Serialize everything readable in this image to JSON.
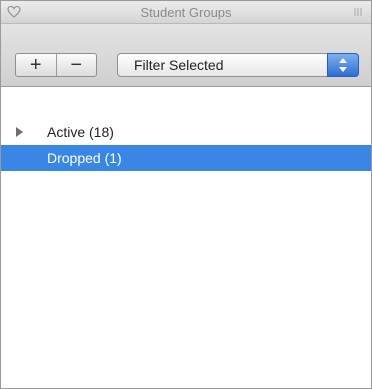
{
  "window": {
    "title": "Student Groups"
  },
  "toolbar": {
    "add_label": "+",
    "remove_label": "−",
    "filter_label": "Filter Selected"
  },
  "groups": [
    {
      "label": "Active (18)",
      "selected": false
    },
    {
      "label": "Dropped (1)",
      "selected": true
    }
  ],
  "colors": {
    "selection": "#3a86e4",
    "stepper": "#2d6fd2"
  }
}
